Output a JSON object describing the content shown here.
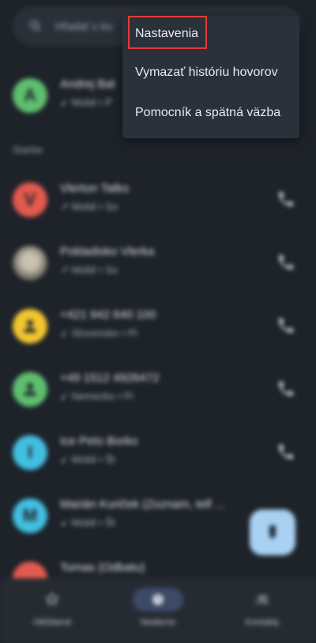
{
  "search": {
    "placeholder_text": "Hľadať v ko"
  },
  "section": {
    "label": "Starbe"
  },
  "colors": {
    "avatar_green": "#5fbf6e",
    "avatar_red": "#e25a4f",
    "avatar_yellow": "#f2c531",
    "avatar_teal": "#42bfe0",
    "fab": "#a9d1f2",
    "highlight": "#e53935"
  },
  "pinned_contact": {
    "initial": "A",
    "name": "Andrej Bal",
    "sub": "↙ Mobil • P"
  },
  "calls": [
    {
      "initial": "V",
      "name": "Vlerton Tatko",
      "sub": "↗ Mobil • So",
      "avatar": "letter"
    },
    {
      "initial": "",
      "name": "Pokladisko Vlerka",
      "sub": "↗ Mobil • So",
      "avatar": "photo"
    },
    {
      "initial": "",
      "name": "+421 942 640 100",
      "sub": "↙ Slovensko • Pi",
      "avatar": "person"
    },
    {
      "initial": "",
      "name": "+49 1512 4926472",
      "sub": "↙ Nemecko • Pi",
      "avatar": "person"
    },
    {
      "initial": "I",
      "name": "Ice Peto Borko",
      "sub": "↙ Mobil • Št",
      "avatar": "letter"
    },
    {
      "initial": "M",
      "name": "Marián Kuriček (Zoznam, telf ...",
      "sub": "↙ Mobil • Št",
      "avatar": "letter"
    },
    {
      "initial": "",
      "name": "Tomas (Odbatu)",
      "sub": "",
      "avatar": "letter"
    }
  ],
  "nav": {
    "favorites": "Obľúbené",
    "recents": "Nedávne",
    "contacts": "Kontakty"
  },
  "menu": {
    "items": [
      "Nastavenia",
      "Vymazať históriu hovorov",
      "Pomocník a spätná väzba"
    ]
  }
}
